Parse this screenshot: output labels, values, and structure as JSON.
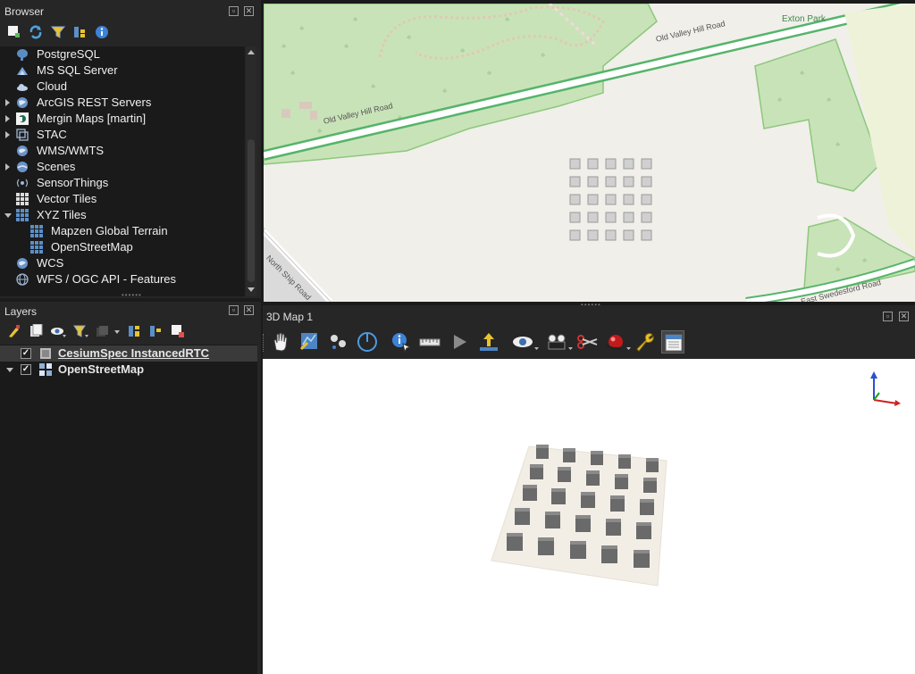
{
  "browser": {
    "title": "Browser",
    "items": [
      {
        "label": "PostgreSQL",
        "icon": "postgresql-elephant-icon",
        "expander": "none"
      },
      {
        "label": "MS SQL Server",
        "icon": "mssql-icon",
        "expander": "none"
      },
      {
        "label": "Cloud",
        "icon": "cloud-icon",
        "expander": "none"
      },
      {
        "label": "ArcGIS REST Servers",
        "icon": "arcgis-globe-icon",
        "expander": "collapsed"
      },
      {
        "label": "Mergin Maps [martin]",
        "icon": "mergin-maps-icon",
        "expander": "collapsed"
      },
      {
        "label": "STAC",
        "icon": "stac-icon",
        "expander": "collapsed"
      },
      {
        "label": "WMS/WMTS",
        "icon": "globe-icon",
        "expander": "none"
      },
      {
        "label": "Scenes",
        "icon": "scenes-globe-icon",
        "expander": "collapsed"
      },
      {
        "label": "SensorThings",
        "icon": "sensor-icon",
        "expander": "none"
      },
      {
        "label": "Vector Tiles",
        "icon": "grid-icon",
        "expander": "none"
      },
      {
        "label": "XYZ Tiles",
        "icon": "grid-icon",
        "expander": "expanded"
      },
      {
        "label": "Mapzen Global Terrain",
        "icon": "grid-icon",
        "expander": "child"
      },
      {
        "label": "OpenStreetMap",
        "icon": "grid-icon",
        "expander": "child"
      },
      {
        "label": "WCS",
        "icon": "globe-icon",
        "expander": "none"
      },
      {
        "label": "WFS / OGC API - Features",
        "icon": "globe-outline-icon",
        "expander": "none"
      }
    ]
  },
  "layers": {
    "title": "Layers",
    "items": [
      {
        "label": "CesiumSpec InstancedRTC",
        "checked": true,
        "selected": true,
        "icon": "point-cloud-icon"
      },
      {
        "label": "OpenStreetMap",
        "checked": true,
        "selected": false,
        "icon": "tile-layer-icon"
      }
    ]
  },
  "map": {
    "labels": {
      "road1": "Old Valley Hill Road",
      "road2": "Old Valley Hill Road",
      "park": "Exton Park",
      "road3": "North Ship Road",
      "road4": "East Swedesford Road"
    }
  },
  "map3d": {
    "title": "3D Map 1"
  },
  "colors": {
    "panel": "#262626",
    "tree_bg": "#1a1a1a",
    "map_bg": "#f1efe9",
    "park_green": "#c9e3b8",
    "park_edge": "#8cc87d",
    "road_edge": "#55b46a"
  }
}
